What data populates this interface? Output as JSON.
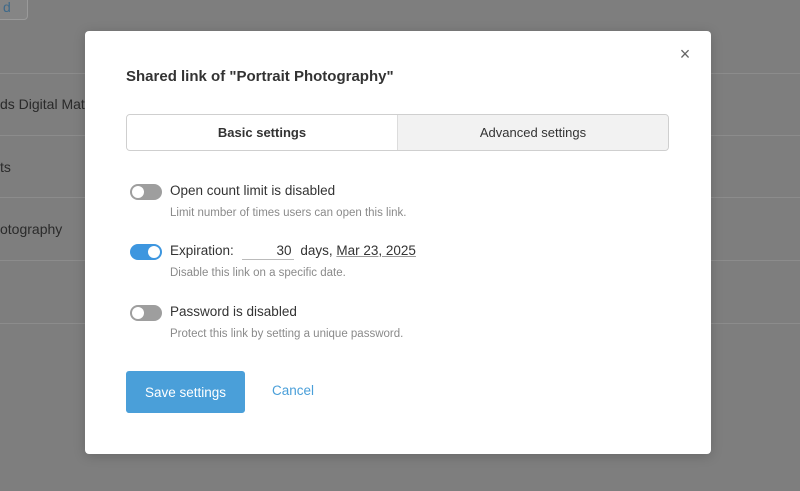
{
  "background": {
    "top_button": "d",
    "rows": [
      {
        "text": "ds Digital Mat"
      },
      {
        "text": "ts"
      },
      {
        "text": "otography"
      }
    ]
  },
  "modal": {
    "title": "Shared link of \"Portrait Photography\"",
    "close_label": "×",
    "tabs": [
      {
        "label": "Basic settings",
        "active": true
      },
      {
        "label": "Advanced settings",
        "active": false
      }
    ],
    "settings": {
      "open_count": {
        "enabled": false,
        "label": "Open count limit",
        "status": "is disabled",
        "description": "Limit number of times users can open this link."
      },
      "expiration": {
        "enabled": true,
        "label": "Expiration:",
        "days_value": "30",
        "days_unit": "days,",
        "date": "Mar 23, 2025",
        "description": "Disable this link on a specific date."
      },
      "password": {
        "enabled": false,
        "label": "Password",
        "status": "is disabled",
        "description": "Protect this link by setting a unique password."
      }
    },
    "save_label": "Save settings",
    "cancel_label": "Cancel"
  },
  "colors": {
    "accent": "#4a9fd9",
    "toggle_on": "#3d96df",
    "toggle_off": "#9e9e9e",
    "overlay": "#7e7e7e"
  }
}
